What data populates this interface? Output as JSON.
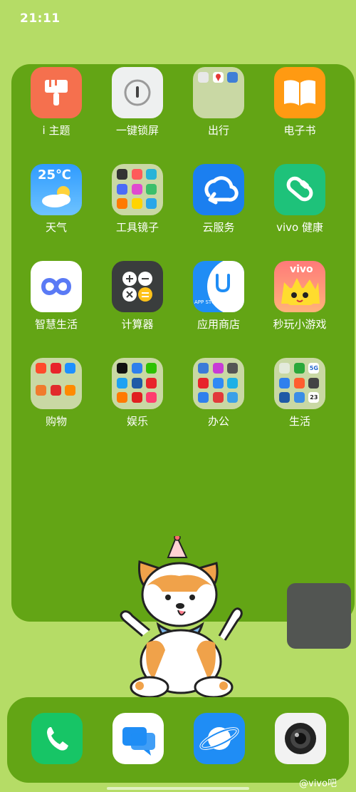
{
  "status_bar": {
    "time": "21:11"
  },
  "apps": {
    "theme": "i 主题",
    "lock": "一键锁屏",
    "travel": "出行",
    "ebook": "电子书",
    "weather": "天气",
    "weather_temp": "25℃",
    "tools": "工具镜子",
    "cloud": "云服务",
    "health": "vivo 健康",
    "smartlife": "智慧生活",
    "calculator": "计算器",
    "appstore": "应用商店",
    "appstore_text": "APP STORE",
    "games": "秒玩小游戏",
    "games_brand": "vivo",
    "shopping": "购物",
    "entertainment": "娱乐",
    "office": "办公",
    "life": "生活"
  },
  "folder_icons": {
    "life_5g": "5G",
    "life_date": "23"
  },
  "watermark": "@vivo吧",
  "colors": {
    "wallpaper": "#b5dc66",
    "panel": "#63a515",
    "accent_blue": "#1b7ff0"
  }
}
